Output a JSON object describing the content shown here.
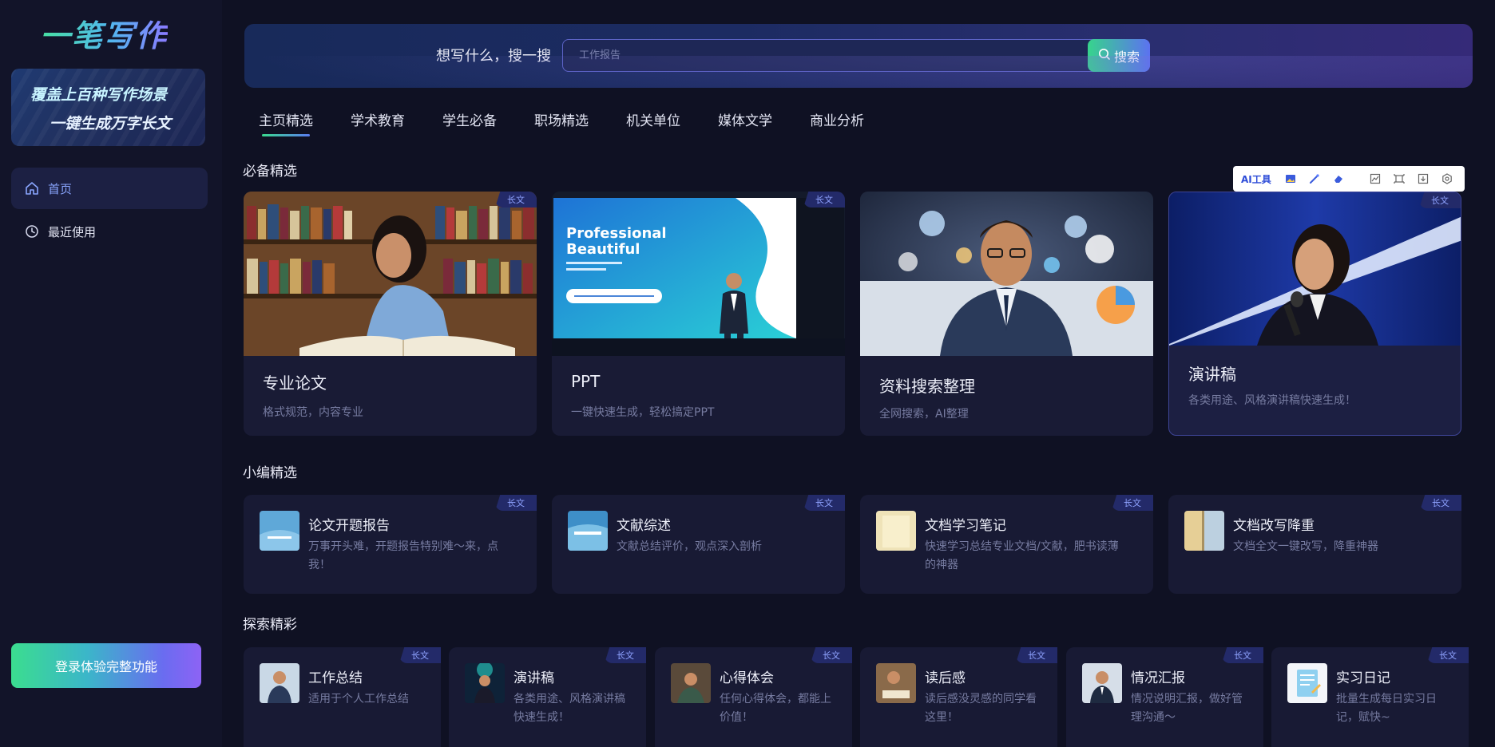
{
  "app": {
    "logo_text": "一笔写作"
  },
  "sidebar": {
    "banner_line1": "覆盖上百种写作场景",
    "banner_line2": "一键生成万字长文",
    "items": [
      {
        "label": "首页",
        "icon": "home-icon",
        "active": true
      },
      {
        "label": "最近使用",
        "icon": "clock-icon",
        "active": false
      }
    ],
    "login_button": "登录体验完整功能"
  },
  "search": {
    "label": "想写什么，搜一搜",
    "placeholder": "工作报告",
    "button": "搜索"
  },
  "tabs": [
    "主页精选",
    "学术教育",
    "学生必备",
    "职场精选",
    "机关单位",
    "媒体文学",
    "商业分析"
  ],
  "active_tab": "主页精选",
  "ai_toolbar": {
    "label": "AI工具",
    "icons": [
      "image-icon",
      "magic-wand-icon",
      "eraser-icon",
      "chart-icon",
      "crop-icon",
      "download-icon",
      "settings-icon"
    ]
  },
  "sections": {
    "featured": "必备精选",
    "editor": "小编精选",
    "explore": "探索精彩"
  },
  "badge": "长文",
  "featured_cards": [
    {
      "title": "专业论文",
      "desc": "格式规范，内容专业"
    },
    {
      "title": "PPT",
      "desc": "一键快速生成，轻松搞定PPT",
      "slide_line1": "Professional",
      "slide_line2": "Beautiful"
    },
    {
      "title": "资料搜索整理",
      "desc": "全网搜索，AI整理"
    },
    {
      "title": "演讲稿",
      "desc": "各类用途、风格演讲稿快速生成！"
    }
  ],
  "editor_cards": [
    {
      "title": "论文开题报告",
      "desc": "万事开头难，开题报告特别难～来，点我！"
    },
    {
      "title": "文献综述",
      "desc": "文献总结评价，观点深入剖析"
    },
    {
      "title": "文档学习笔记",
      "desc": "快速学习总结专业文档/文献，肥书读薄的神器"
    },
    {
      "title": "文档改写降重",
      "desc": "文档全文一键改写，降重神器"
    }
  ],
  "explore_cards": [
    {
      "title": "工作总结",
      "desc": "适用于个人工作总结"
    },
    {
      "title": "演讲稿",
      "desc": "各类用途、风格演讲稿快速生成！"
    },
    {
      "title": "心得体会",
      "desc": "任何心得体会，都能上价值！"
    },
    {
      "title": "读后感",
      "desc": "读后感没灵感的同学看这里！"
    },
    {
      "title": "情况汇报",
      "desc": "情况说明汇报，做好管理沟通～"
    },
    {
      "title": "实习日记",
      "desc": "批量生成每日实习日记，赋快~"
    }
  ]
}
